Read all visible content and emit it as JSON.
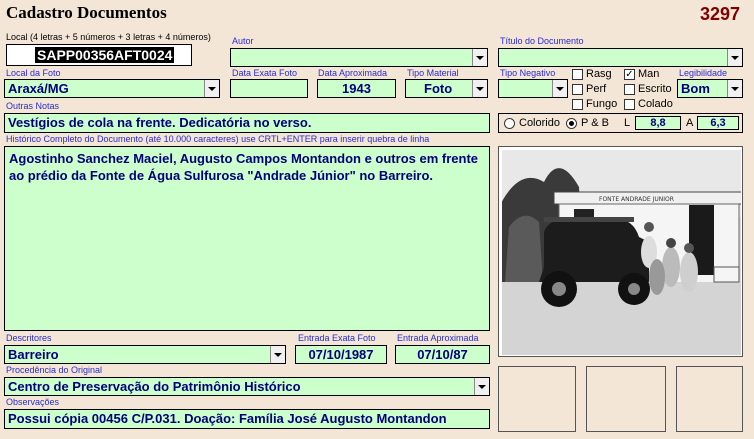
{
  "form": {
    "title": "Cadastro Documentos",
    "record_number": "3297"
  },
  "local": {
    "label": "Local (4 letras + 5 números + 3 letras + 4 números)",
    "value": "SAPP00356AFT0024"
  },
  "autor": {
    "label": "Autor",
    "value": ""
  },
  "titulo": {
    "label": "Título do Documento",
    "value": ""
  },
  "local_foto": {
    "label": "Local da Foto",
    "value": "Araxá/MG"
  },
  "data_exata_foto": {
    "label": "Data Exata Foto",
    "value": ""
  },
  "data_aproximada": {
    "label": "Data Aproximada",
    "value": "1943"
  },
  "tipo_material": {
    "label": "Tipo Material",
    "value": "Foto"
  },
  "tipo_negativo": {
    "label": "Tipo Negativo",
    "value": ""
  },
  "condicao": {
    "rasg": {
      "label": "Rasg",
      "checked": false
    },
    "perf": {
      "label": "Perf",
      "checked": false
    },
    "fungo": {
      "label": "Fungo",
      "checked": false
    },
    "man": {
      "label": "Man",
      "checked": true
    },
    "escrito": {
      "label": "Escrito",
      "checked": false
    },
    "colado": {
      "label": "Colado",
      "checked": false
    }
  },
  "legibilidade": {
    "label": "Legibilidade",
    "value": "Bom"
  },
  "outras_notas": {
    "label": "Outras Notas",
    "value": "Vestígios de cola na frente. Dedicatória no verso."
  },
  "cor": {
    "colorido_label": "Colorido",
    "pb_label": "P & B",
    "selected": "P & B"
  },
  "dimensoes": {
    "l_label": "L",
    "l_value": "8,8",
    "a_label": "A",
    "a_value": "6,3"
  },
  "historico": {
    "label": "Histórico Completo do Documento (até 10.000 caracteres) use CRTL+ENTER para inserir quebra de linha",
    "value": "Agostinho Sanchez Maciel, Augusto Campos Montandon e outros em frente ao prédio da Fonte de Água Sulfurosa \"Andrade Júnior\" no Barreiro."
  },
  "photo": {
    "building_sign": "FONTE ANDRADE JUNIOR"
  },
  "descritores": {
    "label": "Descritores",
    "value": "Barreiro"
  },
  "entrada_exata_foto": {
    "label": "Entrada Exata Foto",
    "value": "07/10/1987"
  },
  "entrada_aproximada": {
    "label": "Entrada Aproximada",
    "value": "07/10/87"
  },
  "procedencia": {
    "label": "Procedência do Original",
    "value": "Centro de Preservação do Patrimônio Histórico"
  },
  "observacoes": {
    "label": "Observações",
    "value": "Possui cópia 00456 C/P.031. Doação: Família José Augusto Montandon"
  },
  "colors": {
    "field_bg": "#ccffcc",
    "form_bg": "#f3e6d6",
    "label_blue": "#2b2bd0",
    "record_red": "#800000"
  }
}
